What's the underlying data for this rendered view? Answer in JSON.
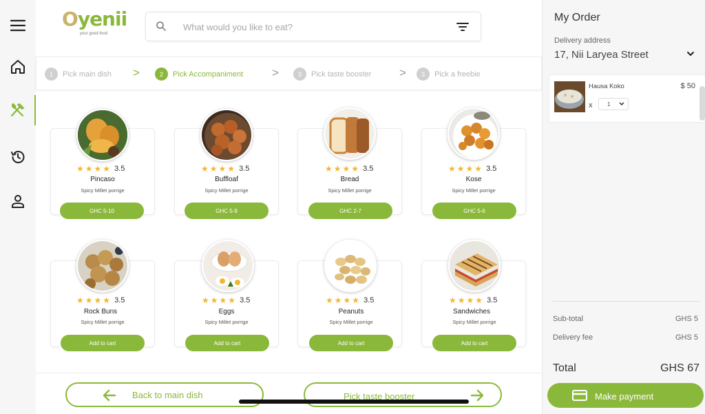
{
  "brand": {
    "name_o": "O",
    "name_rest": "yenii",
    "tagline": "your good food",
    "color": "#8ab83a"
  },
  "nav": [
    {
      "icon": "menu-icon"
    },
    {
      "icon": "home-icon"
    },
    {
      "icon": "utensils-icon",
      "active": true
    },
    {
      "icon": "history-icon"
    },
    {
      "icon": "user-icon"
    }
  ],
  "search": {
    "placeholder": "What would you like to eat?"
  },
  "steps": [
    {
      "num": "1",
      "label": "Pick main dish",
      "state": "done"
    },
    {
      "num": "2",
      "label": "Pick Accompaniment",
      "state": "active"
    },
    {
      "num": "3",
      "label": "Pick taste booster",
      "state": "todo"
    },
    {
      "num": "3",
      "label": "Pick a freebie",
      "state": "todo"
    }
  ],
  "step_separator": ">",
  "items": [
    {
      "name": "Pincaso",
      "desc": "Spicy Millet porrige",
      "rating": "3.5",
      "button": "GHC 5-10"
    },
    {
      "name": "Buffloaf",
      "desc": "Spicy Millet porrige",
      "rating": "3.5",
      "button": "GHC 5-9"
    },
    {
      "name": "Bread",
      "desc": "Spicy Millet porrige",
      "rating": "3.5",
      "button": "GHC 2-7"
    },
    {
      "name": "Kose",
      "desc": "Spicy Millet porrige",
      "rating": "3.5",
      "button": "GHC 5-6"
    },
    {
      "name": "Rock Buns",
      "desc": "Spicy Millet porrige",
      "rating": "3.5",
      "button": "Add to cart"
    },
    {
      "name": "Eggs",
      "desc": "Spicy Millet porrige",
      "rating": "3.5",
      "button": "Add to cart"
    },
    {
      "name": "Peanuts",
      "desc": "Spicy Millet porrige",
      "rating": "3.5",
      "button": "Add to cart"
    },
    {
      "name": "Sandwiches",
      "desc": "Spicy Millet porrige",
      "rating": "3.5",
      "button": "Add to cart"
    }
  ],
  "bottom": {
    "back_label": "Back to main dish",
    "next_label": "Pick taste booster"
  },
  "order": {
    "title": "My Order",
    "address_label": "Delivery address",
    "address": "17, Nii Laryea Street",
    "item": {
      "name": "Hausa Koko",
      "price": "$ 50",
      "times": "x",
      "qty": "1"
    },
    "subtotal_label": "Sub-total",
    "subtotal": "GHS 5",
    "delivery_label": "Delivery fee",
    "delivery": "GHS 5",
    "total_label": "Total",
    "total": "GHS 67",
    "pay_label": "Make payment"
  },
  "colors": {
    "accent": "#8ab83a",
    "star": "#f2b632"
  }
}
